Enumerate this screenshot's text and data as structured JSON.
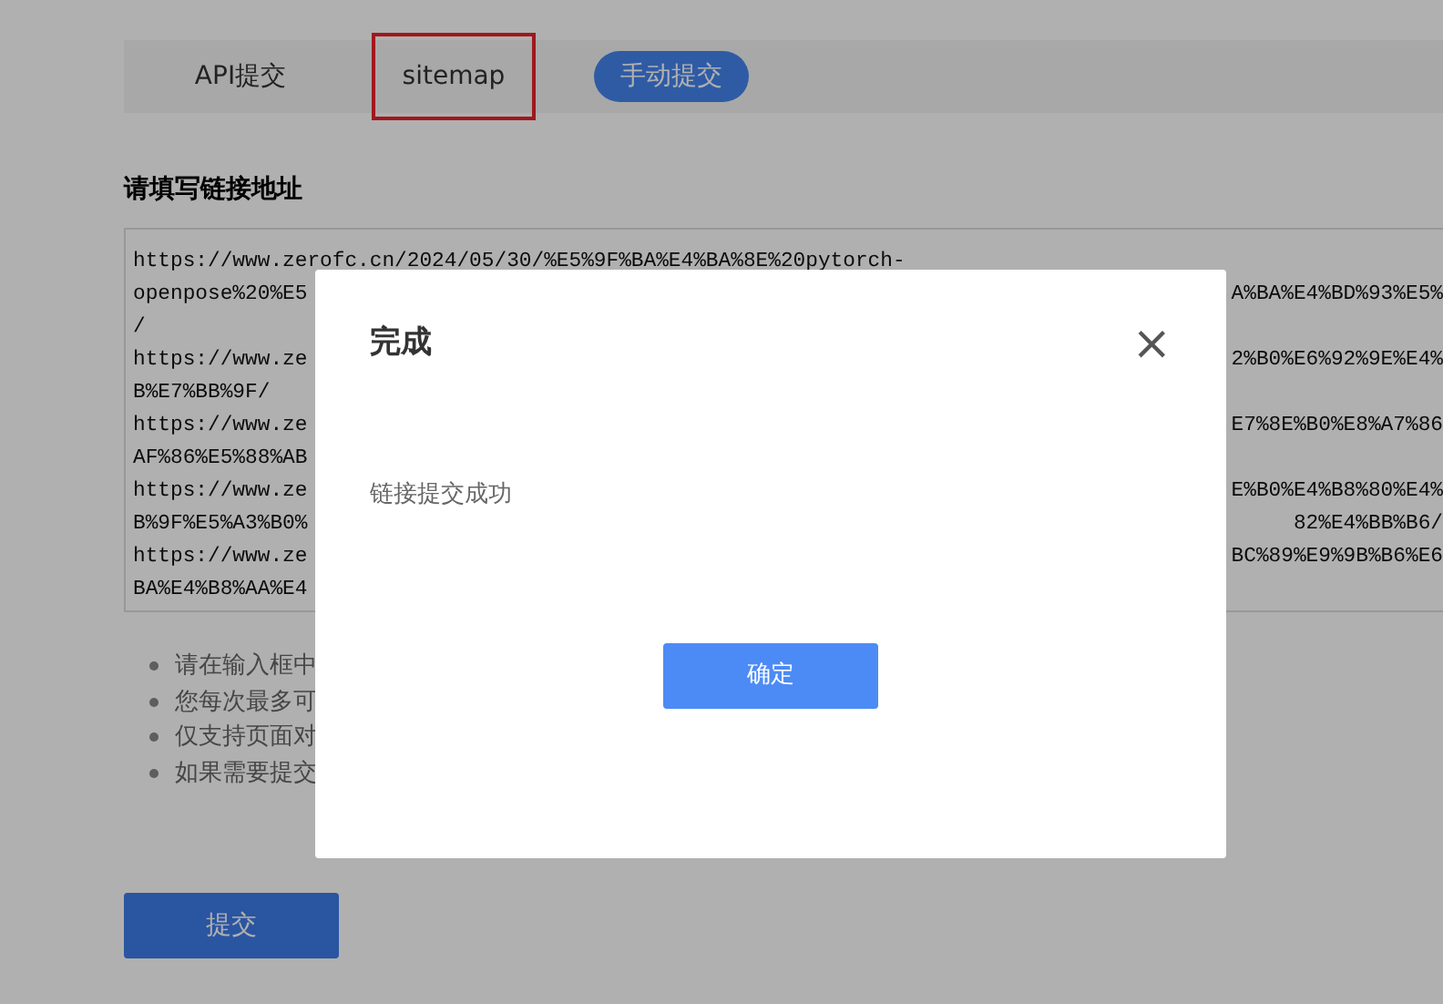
{
  "tabs": [
    {
      "label": "API提交",
      "selected": false,
      "highlighted": false
    },
    {
      "label": "sitemap",
      "selected": false,
      "highlighted": true
    },
    {
      "label": "手动提交",
      "selected": true,
      "highlighted": false
    }
  ],
  "url_section": {
    "heading": "请填写链接地址",
    "lines": [
      {
        "left": "https://www.zerofc.cn/2024/05/30/%E5%9F%BA%E4%BA%8E%20pytorch-"
      },
      {
        "left": "openpose%20%E5",
        "right": "A%BA%E4%BD%93%E5%"
      },
      {
        "left": "/"
      },
      {
        "left": "https://www.ze",
        "right": "2%B0%E6%92%9E%E4%"
      },
      {
        "left": "B%E7%BB%9F/"
      },
      {
        "left": "https://www.ze",
        "right": "E7%8E%B0%E8%A7%86"
      },
      {
        "left": "AF%86%E5%88%AB"
      },
      {
        "left": "https://www.ze",
        "right": "E%B0%E4%B8%80%E4%"
      },
      {
        "left": "B%9F%E5%A3%B0%",
        "right": "82%E4%BB%B6/"
      },
      {
        "left": "https://www.ze",
        "right": "BC%89%E9%9B%B6%E6"
      },
      {
        "left": "BA%E4%B8%AA%E4"
      }
    ]
  },
  "notes": [
    "请在输入框中",
    "您每次最多可",
    "仅支持页面对",
    "如果需要提交"
  ],
  "submit_button": "提交",
  "dialog": {
    "title": "完成",
    "close": "×",
    "message": "链接提交成功",
    "confirm": "确定"
  }
}
